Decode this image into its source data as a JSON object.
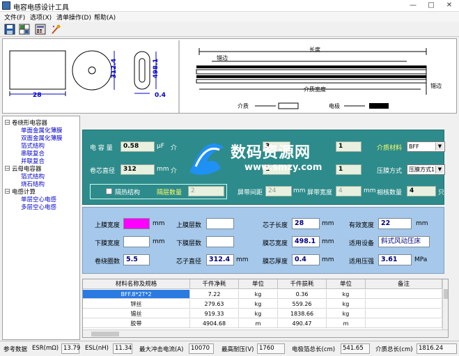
{
  "window": {
    "title": "电容电感设计工具",
    "min": "—",
    "max": "□",
    "close": "✕"
  },
  "menu": [
    "文件(F)",
    "选项(X)",
    "清单操作(D)",
    "帮助(A)"
  ],
  "toolbar": [
    {
      "icon": "save-icon",
      "color": "#2a5fa8"
    },
    {
      "icon": "grid-icon",
      "color": "#3a8a3a"
    },
    {
      "icon": "calc-icon",
      "color": "#6a6aa8"
    },
    {
      "icon": "magic-wand-icon",
      "color": "#c05020"
    }
  ],
  "drawing": {
    "width_label": "28",
    "height_label": "312.4",
    "dia_label": "498.1",
    "thick_label": "0.4",
    "tape_length": "长度",
    "tape_margin": "错边",
    "tape_width": "介质宽度",
    "tape_side": "错边",
    "legend_dielectric": "介质",
    "legend_electrode": "电极"
  },
  "tree": [
    {
      "label": "卷绕形电容器",
      "level": 0,
      "box": "⊟"
    },
    {
      "label": "单面金属化薄膜",
      "level": 1
    },
    {
      "label": "双面金属化薄膜",
      "level": 1
    },
    {
      "label": "箔式结构",
      "level": 1
    },
    {
      "label": "串联复合",
      "level": 1
    },
    {
      "label": "并联复合",
      "level": 1
    },
    {
      "label": "云母电容器",
      "level": 0,
      "box": "⊟"
    },
    {
      "label": "箔式结构",
      "level": 1
    },
    {
      "label": "烧石结构",
      "level": 1
    },
    {
      "label": "电感计算",
      "level": 0,
      "box": "⊟"
    },
    {
      "label": "单层空心电感",
      "level": 1
    },
    {
      "label": "多层空心电感",
      "level": 1
    }
  ],
  "teal": {
    "cap_label": "电 容 量",
    "cap_value": "0.58",
    "cap_unit": "μF",
    "core_dia_label": "卷芯直径",
    "core_dia_value": "312",
    "core_dia_unit": "mm",
    "mid1_value": "3",
    "mid2_value": "1",
    "right1_value": "1",
    "right2_value": "1",
    "dielectric_label": "介质材料",
    "dielectric_value": "BFF",
    "metal_label": "压膜方式",
    "metal_value": "压膜方式1",
    "checkbox_label": "隔热结构",
    "segments_label": "隔层数量",
    "segments_value": "2",
    "gap_label": "屏带间距",
    "gap_value": "24",
    "gap_unit": "mm",
    "shield_width_label": "屏带宽度",
    "shield_width_value": "4",
    "shield_width_unit": "mm",
    "phase_label": "相核数量",
    "phase_value": "4",
    "phase_unit": "只",
    "overlay_text": "数码资源网",
    "overlay_url": "www.smzy.com",
    "partial1": "介",
    "partial2": "介",
    "partial3": "mm"
  },
  "blue": {
    "top_film_label": "上膜宽度",
    "top_film_value": "",
    "top_film_unit": "mm",
    "top_layers_label": "上膜层数",
    "top_layers_value": "",
    "core_len_label": "芯子长度",
    "core_len_value": "28",
    "core_len_unit": "mm",
    "eff_width_label": "有效宽度",
    "eff_width_value": "22",
    "eff_width_unit": "mm",
    "bot_film_label": "下膜宽度",
    "bot_film_value": "",
    "bot_film_unit": "mm",
    "bot_layers_label": "下膜层数",
    "bot_layers_value": "",
    "chip_width_label": "膜芯宽度",
    "chip_width_value": "498.1",
    "chip_width_unit": "mm",
    "device_label": "适用设备",
    "device_value": "斜式风动压床",
    "turns_label": "卷绕圈数",
    "turns_value": "5.5",
    "core_dia_label": "芯子直径",
    "core_dia_value": "312.4",
    "core_dia_unit": "mm",
    "chip_thick_label": "膜芯厚度",
    "chip_thick_value": "0.4",
    "chip_thick_unit": "mm",
    "pressure_label": "适用压强",
    "pressure_value": "3.61",
    "pressure_unit": "MPa"
  },
  "table": {
    "headers": [
      "材料名称及规格",
      "千件净耗",
      "单位",
      "千件损耗",
      "单位",
      "备注"
    ],
    "rows": [
      [
        "BFF.8*2T*2",
        "7.22",
        "kg",
        "0.36",
        "kg",
        ""
      ],
      [
        "锌丝",
        "279.63",
        "kg",
        "559.26",
        "kg",
        ""
      ],
      [
        "锡丝",
        "919.33",
        "kg",
        "1838.66",
        "kg",
        ""
      ],
      [
        "胶带",
        "4904.68",
        "m",
        "490.47",
        "m",
        ""
      ]
    ]
  },
  "status": {
    "ref_label": "参考数据",
    "esr_label": "ESR(mΩ)",
    "esr_value": "13.79",
    "esl_label": "ESL(nH)",
    "esl_value": "11.34",
    "surge_label": "最大冲击电流(A)",
    "surge_value": "10070",
    "volt_label": "最高耐压(V)",
    "volt_value": "1760",
    "elec_len_label": "电极箔总长(cm)",
    "elec_len_value": "541.65",
    "diel_len_label": "介质总长(cm)",
    "diel_len_value": "1816.24"
  }
}
